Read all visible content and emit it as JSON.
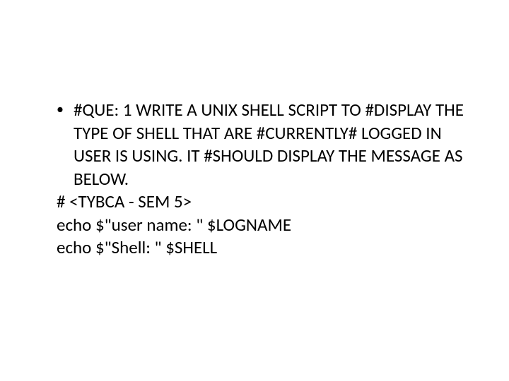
{
  "slide": {
    "bullet": {
      "marker": "•",
      "text": "#QUE: 1 WRITE A UNIX SHELL SCRIPT TO #DISPLAY THE TYPE OF SHELL THAT ARE #CURRENTLY# LOGGED IN USER IS USING. IT #SHOULD DISPLAY THE MESSAGE AS BELOW."
    },
    "lines": [
      "# <TYBCA - SEM 5>",
      "echo $\"user name: \" $LOGNAME",
      "echo $\"Shell: \" $SHELL"
    ]
  }
}
